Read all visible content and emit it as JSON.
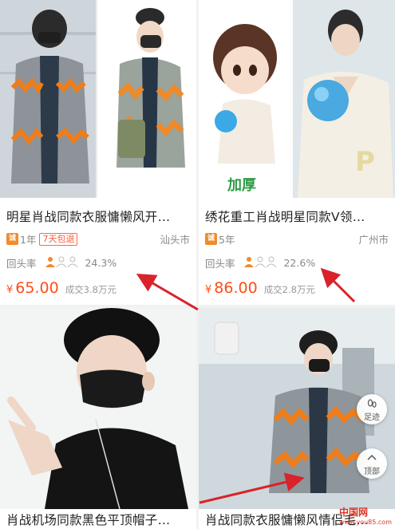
{
  "products": [
    {
      "title": "明星肖战同款衣服慵懒风开…",
      "years": "1年",
      "shipping": "7天包退",
      "city": "汕头市",
      "rate_label": "回头率",
      "rate": "24.3%",
      "currency": "¥",
      "price": "65.00",
      "sold": "成交3.8万元"
    },
    {
      "title": "绣花重工肖战明星同款V领…",
      "years": "5年",
      "city": "广州市",
      "rate_label": "回头率",
      "rate": "22.6%",
      "currency": "¥",
      "price": "86.00",
      "sold": "成交2.8万元",
      "image_text": "加厚"
    },
    {
      "title": "肖战机场同款黑色平顶帽子…"
    },
    {
      "title": "肖战同款衣服慵懒风情侣毛…"
    }
  ],
  "badge_text": "诚",
  "float_buttons": {
    "footprint": "足迹",
    "top": "顶部"
  },
  "watermark": {
    "main": "中国网",
    "sub": "www.you85.com"
  },
  "colors": {
    "price": "#ff4d17",
    "shipping_tag": "#ff5a36",
    "badge": "#f08c2e",
    "arrow": "#d8232a"
  }
}
